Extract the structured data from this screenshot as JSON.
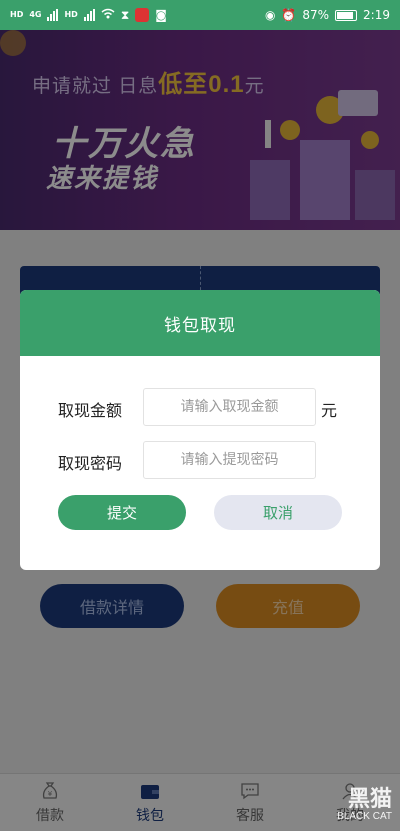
{
  "status_bar": {
    "left_tags": [
      "HD",
      "HD"
    ],
    "network": "4G",
    "battery": "87%",
    "time": "2:19"
  },
  "banner": {
    "line1_prefix": "申请就过  日息",
    "line1_highlight": "低至0.1",
    "line1_suffix": "元",
    "big_line1": "十万火急",
    "big_line2": "速来提钱"
  },
  "background": {
    "loan_detail_button": "借款详情",
    "recharge_button": "充值"
  },
  "dialog": {
    "title": "钱包取现",
    "amount_label": "取现金额",
    "amount_placeholder": "请输入取现金额",
    "amount_value": "",
    "unit": "元",
    "password_label": "取现密码",
    "password_placeholder": "请输入提现密码",
    "password_value": "",
    "submit_label": "提交",
    "cancel_label": "取消"
  },
  "tabbar": {
    "items": [
      {
        "label": "借款",
        "icon": "money-bag-icon"
      },
      {
        "label": "钱包",
        "icon": "wallet-icon"
      },
      {
        "label": "客服",
        "icon": "chat-icon"
      },
      {
        "label": "我的",
        "icon": "user-icon"
      }
    ],
    "active_index": 1
  },
  "watermark": {
    "brand": "黑猫",
    "sub": "BLACK CAT"
  },
  "colors": {
    "primary_green": "#3aa06b",
    "navy": "#1c3a7a",
    "orange": "#d98a22"
  }
}
